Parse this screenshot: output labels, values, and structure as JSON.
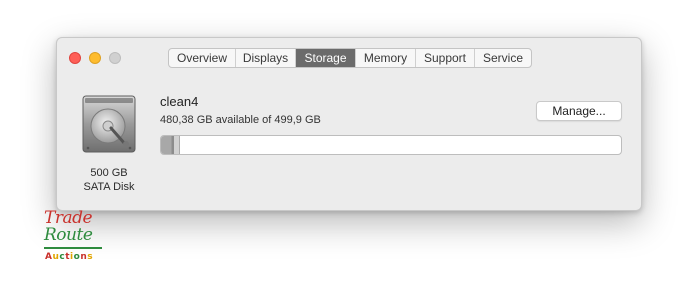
{
  "window": {
    "tabs": [
      {
        "label": "Overview",
        "active": false
      },
      {
        "label": "Displays",
        "active": false
      },
      {
        "label": "Storage",
        "active": true
      },
      {
        "label": "Memory",
        "active": false
      },
      {
        "label": "Support",
        "active": false
      },
      {
        "label": "Service",
        "active": false
      }
    ],
    "colors": {
      "close": "#fe5f57",
      "minimize": "#febc2e",
      "zoom": "#d0d0d0",
      "active_tab": "#6b6b6b"
    }
  },
  "disk": {
    "icon": "hard-drive-icon",
    "size": "500 GB",
    "type": "SATA Disk"
  },
  "volume": {
    "name": "clean4",
    "availability": "480,38 GB available of 499,9 GB",
    "used_fraction": 0.039,
    "manage_label": "Manage..."
  },
  "watermark": {
    "line1": "Trade",
    "line2": "Route",
    "line3": "Auctions"
  }
}
